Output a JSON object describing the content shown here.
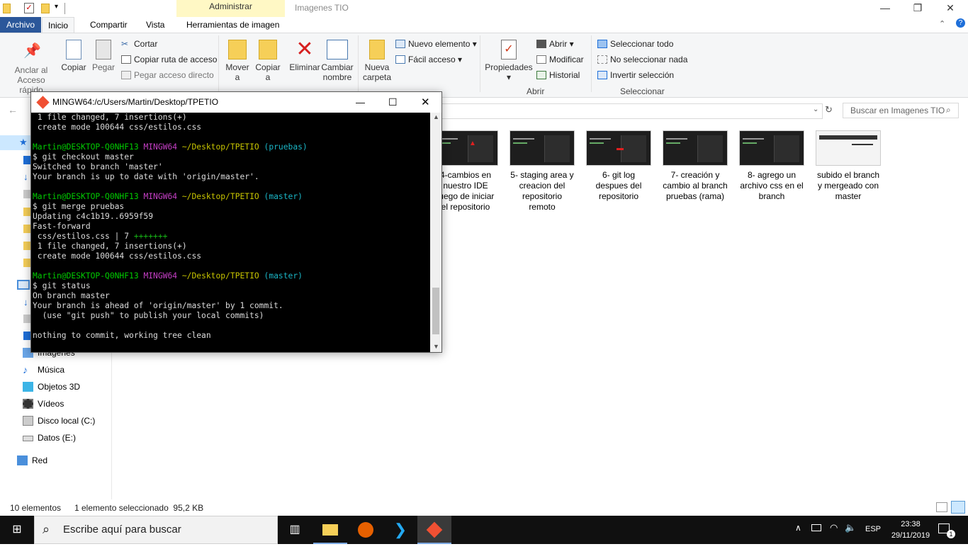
{
  "explorer": {
    "contextual_tab": "Administrar",
    "window_title": "Imagenes TIO",
    "tabs": [
      "Archivo",
      "Inicio",
      "Compartir",
      "Vista",
      "Herramientas de imagen"
    ],
    "ribbon": {
      "anclar": "Anclar al",
      "anclar2": "Acceso rápido",
      "copiar": "Copiar",
      "pegar": "Pegar",
      "cortar": "Cortar",
      "copiar_ruta": "Copiar ruta de acceso",
      "pegar_acceso": "Pegar acceso directo",
      "group_portapapeles": "Portapapeles",
      "mover": "Mover",
      "mover_sub": "a",
      "copiar_a": "Copiar",
      "copiar_a_sub": "a",
      "eliminar": "Eliminar",
      "cambiar": "Cambiar",
      "cambiar2": "nombre",
      "group_organizar": "Organizar",
      "nueva": "Nueva",
      "nueva2": "carpeta",
      "nuevo_elemento": "Nuevo elemento",
      "facil_acceso": "Fácil acceso",
      "group_nuevo": "Nuevo",
      "propiedades": "Propiedades",
      "abrir": "Abrir",
      "modificar": "Modificar",
      "historial": "Historial",
      "group_abrir": "Abrir",
      "seleccionar_todo": "Seleccionar todo",
      "no_seleccionar": "No seleccionar nada",
      "invertir": "Invertir selección",
      "group_seleccionar": "Seleccionar"
    },
    "search_placeholder": "Buscar en Imagenes TIO",
    "nav": [
      "Imágenes",
      "Música",
      "Objetos 3D",
      "Vídeos",
      "Disco local (C:)",
      "Datos (E:)",
      "Red"
    ],
    "files": [
      {
        "l1": "4-cambios en",
        "l2": "nuestro IDE",
        "l3": "luego de iniciar",
        "l4": "el repositorio"
      },
      {
        "l1": "5- staging area y",
        "l2": "creacion del",
        "l3": "repositorio",
        "l4": "remoto"
      },
      {
        "l1": "6- git log",
        "l2": "despues del",
        "l3": "repositorio",
        "l4": ""
      },
      {
        "l1": "7- creación y",
        "l2": "cambio al branch",
        "l3": "pruebas (rama)",
        "l4": ""
      },
      {
        "l1": "8-  agrego un",
        "l2": "archivo css en el",
        "l3": "branch",
        "l4": ""
      },
      {
        "l1": "subido el branch",
        "l2": "y mergeado con",
        "l3": "master",
        "l4": ""
      }
    ],
    "status_count": "10 elementos",
    "status_selected": "1 elemento seleccionado  95,2 KB"
  },
  "terminal": {
    "title": "MINGW64:/c/Users/Martin/Desktop/TPETIO",
    "user": "Martin@DESKTOP-Q0NHF13",
    "env": "MINGW64",
    "path": "~/Desktop/TPETIO",
    "l1": " 1 file changed, 7 insertions(+)",
    "l2": " create mode 100644 css/estilos.css",
    "b1": "(pruebas)",
    "cmd1": "$ git checkout master",
    "o1": "Switched to branch 'master'",
    "o2": "Your branch is up to date with 'origin/master'.",
    "b2": "(master)",
    "cmd2": "$ git merge pruebas",
    "o3": "Updating c4c1b19..6959f59",
    "o4": "Fast-forward",
    "o5a": " css/estilos.css | 7 ",
    "o5b": "+++++++",
    "o6": " 1 file changed, 7 insertions(+)",
    "o7": " create mode 100644 css/estilos.css",
    "b3": "(master)",
    "cmd3": "$ git status",
    "o8": "On branch master",
    "o9": "Your branch is ahead of 'origin/master' by 1 commit.",
    "o10": "  (use \"git push\" to publish your local commits)",
    "o11": "nothing to commit, working tree clean"
  },
  "taskbar": {
    "search_placeholder": "Escribe aquí para buscar",
    "lang": "ESP",
    "time": "23:38",
    "date": "29/11/2019",
    "notif_count": "1"
  },
  "colors": {
    "accent": "#2b579a",
    "contextual": "#fff8c5",
    "terminal_bg": "#000000"
  }
}
